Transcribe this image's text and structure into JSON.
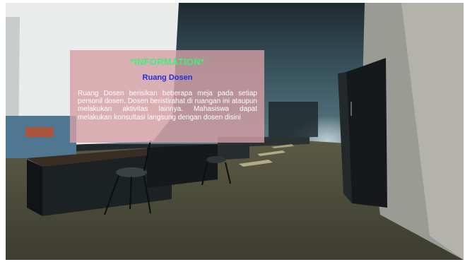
{
  "info_panel": {
    "title": "*INFORMATION*",
    "subtitle": "Ruang Dosen",
    "body": "Ruang Dosen berisikan beberapa meja pada setiap personil dosen. Dosen beristirahat di ruangan ini ataupun melakukan aktivitas lainnya. Mahasiswa dapat melakukan konsultasi langsung dengan dosen disini"
  },
  "colors": {
    "title": "#3cf07a",
    "subtitle": "#1f2ee6",
    "body_text": "#ffffff",
    "panel_background": "#d6a0a6"
  }
}
